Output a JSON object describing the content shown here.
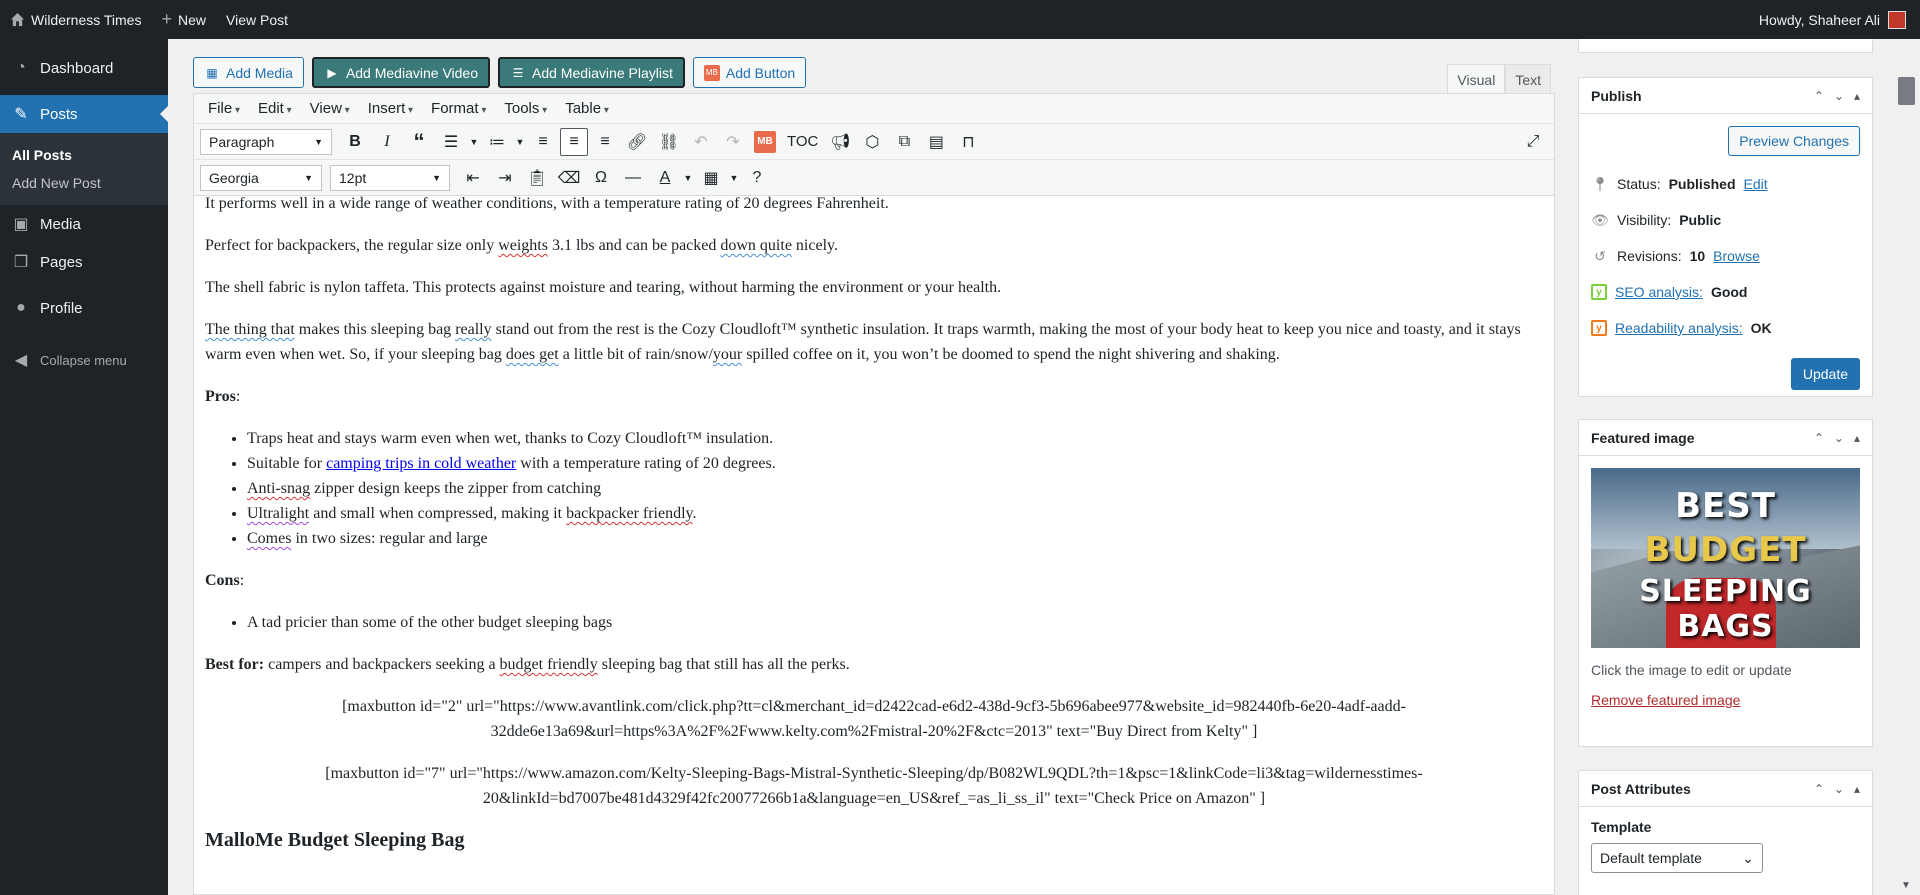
{
  "adminbar": {
    "site_name": "Wilderness Times",
    "new_label": "New",
    "view_post_label": "View Post",
    "howdy": "Howdy, Shaheer Ali"
  },
  "sidebar": {
    "items": [
      {
        "label": "Dashboard",
        "icon": "dashboard-icon"
      },
      {
        "label": "Posts",
        "icon": "pin-icon"
      },
      {
        "label": "Media",
        "icon": "media-icon"
      },
      {
        "label": "Pages",
        "icon": "pages-icon"
      },
      {
        "label": "Profile",
        "icon": "user-icon"
      }
    ],
    "submenu": [
      "All Posts",
      "Add New Post"
    ],
    "collapse": "Collapse menu"
  },
  "media_buttons": {
    "add_media": "Add Media",
    "add_mediavine_video": "Add Mediavine Video",
    "add_mediavine_playlist": "Add Mediavine Playlist",
    "add_button": "Add Button"
  },
  "tabs": {
    "visual": "Visual",
    "text": "Text"
  },
  "menubar": [
    "File",
    "Edit",
    "View",
    "Insert",
    "Format",
    "Tools",
    "Table"
  ],
  "toolbar": {
    "block_format": "Paragraph",
    "font_family": "Georgia",
    "font_size": "12pt",
    "mb_label": "MB",
    "toc_label": "TOC"
  },
  "content": {
    "p0": "It performs well in a wide range of weather conditions, with a temperature rating of 20 degrees Fahrenheit.",
    "p1_a": "Perfect for backpackers, the regular size only ",
    "p1_b": "weights",
    "p1_c": " 3.1 lbs and can be packed ",
    "p1_d": "down quite",
    "p1_e": " nicely.",
    "p2": "The shell fabric is nylon taffeta. This protects against moisture and tearing, without harming the environment or your health.",
    "p3_a": "The thing that",
    "p3_b": " makes this sleeping bag ",
    "p3_c": "really",
    "p3_d": " stand out from the rest is the Cozy Cloudloft™ synthetic insulation. It traps warmth, making the most of your body heat to keep you nice and toasty, and it stays warm even when wet. So, if your sleeping bag ",
    "p3_e": "does get",
    "p3_f": " a little bit of rain/snow/",
    "p3_g": "your",
    "p3_h": " spilled coffee on it, you won’t be doomed to spend the night shivering and shaking.",
    "pros_label": "Pros",
    "pros": {
      "i0": "Traps heat and stays warm even when wet, thanks to Cozy Cloudloft™ insulation.",
      "i1_a": "Suitable for ",
      "i1_link": "camping trips in cold weather",
      "i1_b": " with a temperature rating of 20 degrees.",
      "i2_a": "Anti-snag",
      "i2_b": " zipper design keeps the zipper from catching",
      "i3_a": "Ultralight",
      "i3_b": " and small when compressed, making it ",
      "i3_c": "backpacker friendly",
      "i3_d": ".",
      "i4_a": "Comes",
      "i4_b": " in two sizes: regular and large"
    },
    "cons_label": "Cons",
    "cons": [
      "A tad pricier than some of the other budget sleeping bags"
    ],
    "best_for_label": "Best for:",
    "best_for_a": " campers and backpackers seeking a ",
    "best_for_b": "budget friendly",
    "best_for_c": " sleeping bag that still has all the perks.",
    "shortcode1": "[maxbutton id=\"2\" url=\"https://www.avantlink.com/click.php?tt=cl&merchant_id=d2422cad-e6d2-438d-9cf3-5b696abee977&website_id=982440fb-6e20-4adf-aadd-32dde6e13a69&url=https%3A%2F%2Fwww.kelty.com%2Fmistral-20%2F&ctc=2013\" text=\"Buy Direct from Kelty\" ]",
    "shortcode2": "[maxbutton id=\"7\" url=\"https://www.amazon.com/Kelty-Sleeping-Bags-Mistral-Synthetic-Sleeping/dp/B082WL9QDL?th=1&psc=1&linkCode=li3&tag=wildernesstimes-20&linkId=bd7007be481d4329f42fc20077266b1a&language=en_US&ref_=as_li_ss_il\" text=\"Check Price on Amazon\" ]",
    "heading": "MalloMe Budget Sleeping Bag"
  },
  "publish": {
    "title": "Publish",
    "preview": "Preview Changes",
    "status_label": "Status:",
    "status_value": "Published",
    "status_edit": "Edit",
    "visibility_label": "Visibility:",
    "visibility_value": "Public",
    "revisions_label": "Revisions:",
    "revisions_value": "10",
    "revisions_browse": "Browse",
    "seo_label": "SEO analysis:",
    "seo_value": "Good",
    "readability_label": "Readability analysis:",
    "readability_value": "OK",
    "update": "Update"
  },
  "featured": {
    "title": "Featured image",
    "img_line1": "BEST",
    "img_line2": "BUDGET",
    "img_line3": "SLEEPING BAGS",
    "hint": "Click the image to edit or update",
    "remove": "Remove featured image"
  },
  "attributes": {
    "title": "Post Attributes",
    "template_label": "Template",
    "template_value": "Default template"
  }
}
